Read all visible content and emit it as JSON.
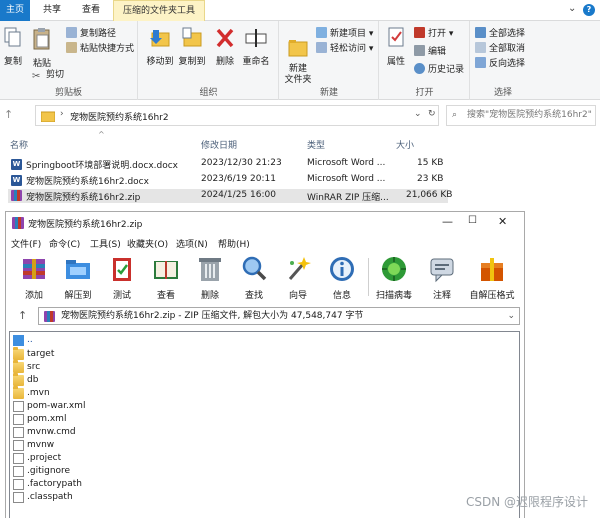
{
  "ribbon_tabs": {
    "file": "主页",
    "share": "共享",
    "view": "查看",
    "context": "压缩的文件夹工具"
  },
  "ribbon": {
    "clipboard": {
      "label": "剪贴板",
      "copy": "复制",
      "paste": "粘贴",
      "copy_path": "复制路径",
      "paste_shortcut": "粘贴快捷方式",
      "cut": "剪切"
    },
    "organize": {
      "label": "组织",
      "move_to": "移动到",
      "copy_to": "复制到",
      "delete": "删除",
      "rename": "重命名"
    },
    "new": {
      "label": "新建",
      "new_folder": "新建\n文件夹",
      "new_item": "新建项目 ▾",
      "easy_access": "轻松访问 ▾"
    },
    "open": {
      "label": "打开",
      "properties": "属性",
      "open": "打开 ▾",
      "edit": "编辑",
      "history": "历史记录"
    },
    "select": {
      "label": "选择",
      "select_all": "全部选择",
      "select_none": "全部取消",
      "invert": "反向选择"
    }
  },
  "address": {
    "path": "宠物医院预约系统16hr2",
    "search_placeholder": "搜索\"宠物医院预约系统16hr2\""
  },
  "columns": {
    "name": "名称",
    "modified": "修改日期",
    "type": "类型",
    "size": "大小"
  },
  "files": [
    {
      "name": "Springboot环境部署说明.docx.docx",
      "date": "2023/12/30 21:23",
      "type": "Microsoft Word ...",
      "size": "15 KB",
      "icon": "word-icon"
    },
    {
      "name": "宠物医院预约系统16hr2.docx",
      "date": "2023/6/19 20:11",
      "type": "Microsoft Word ...",
      "size": "23 KB",
      "icon": "word-icon"
    },
    {
      "name": "宠物医院预约系统16hr2.zip",
      "date": "2024/1/25 16:00",
      "type": "WinRAR ZIP 压缩...",
      "size": "21,066 KB",
      "icon": "zip-icon"
    }
  ],
  "winrar": {
    "title": "宠物医院预约系统16hr2.zip",
    "menu": [
      "文件(F)",
      "命令(C)",
      "工具(S)",
      "收藏夹(O)",
      "选项(N)",
      "帮助(H)"
    ],
    "toolbar": [
      "添加",
      "解压到",
      "测试",
      "查看",
      "删除",
      "查找",
      "向导",
      "信息",
      "扫描病毒",
      "注释",
      "自解压格式"
    ],
    "path": "宠物医院预约系统16hr2.zip - ZIP 压缩文件, 解包大小为 47,548,747 字节",
    "items": [
      {
        "name": "..",
        "kind": "up"
      },
      {
        "name": "target",
        "kind": "folder"
      },
      {
        "name": "src",
        "kind": "folder"
      },
      {
        "name": "db",
        "kind": "folder"
      },
      {
        "name": ".mvn",
        "kind": "folder"
      },
      {
        "name": "pom-war.xml",
        "kind": "file"
      },
      {
        "name": "pom.xml",
        "kind": "file"
      },
      {
        "name": "mvnw.cmd",
        "kind": "file"
      },
      {
        "name": "mvnw",
        "kind": "file"
      },
      {
        "name": ".project",
        "kind": "file"
      },
      {
        "name": ".gitignore",
        "kind": "file"
      },
      {
        "name": ".factorypath",
        "kind": "file"
      },
      {
        "name": ".classpath",
        "kind": "file"
      }
    ]
  },
  "watermark": "CSDN @迟限程序设计"
}
